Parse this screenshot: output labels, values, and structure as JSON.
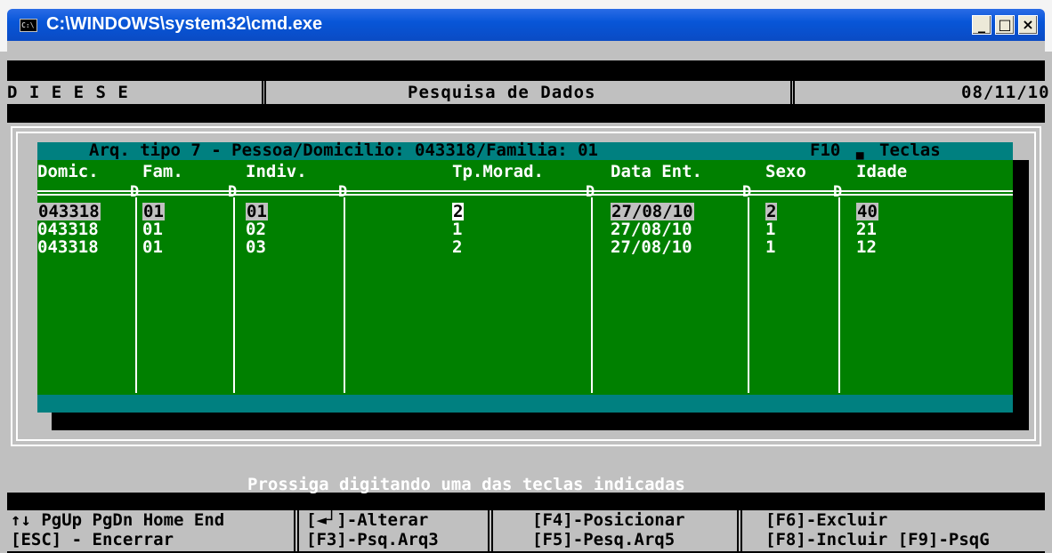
{
  "window": {
    "title": "C:\\WINDOWS\\system32\\cmd.exe",
    "icon_text": "C:\\",
    "minimize": "_",
    "maximize": "□",
    "close": "×"
  },
  "header": {
    "left": "D I E E S E",
    "center": "Pesquisa de Dados",
    "date": "08/11/10"
  },
  "panel": {
    "title": "Arq. tipo 7 - Pessoa/Domicilio: 043318/Familia: 01",
    "help_key": "F10",
    "help_label": "Teclas",
    "columns": [
      "Domic.",
      "Fam.",
      "Indiv.",
      "Tp.Morad.",
      "Data Ent.",
      "Sexo",
      "Idade"
    ],
    "rows": [
      [
        "043318",
        "01",
        "01",
        "2",
        "27/08/10",
        "2",
        "40"
      ],
      [
        "043318",
        "01",
        "02",
        "1",
        "27/08/10",
        "1",
        "21"
      ],
      [
        "043318",
        "01",
        "03",
        "2",
        "27/08/10",
        "1",
        "12"
      ]
    ]
  },
  "status": {
    "prompt": "Prossiga digitando uma das teclas indicadas",
    "keys_line1": [
      "↑↓ PgUp PgDn Home End",
      "[◄┘]-Alterar",
      "[F4]-Posicionar",
      "[F6]-Excluir"
    ],
    "keys_line2": [
      "[ESC] - Encerrar",
      "[F3]-Psq.Arq3",
      "[F5]-Pesq.Arq5",
      "[F8]-Incluir [F9]-PsqG"
    ]
  },
  "colors": {
    "title_bar": "#0a4bc4",
    "panel_green": "#008000",
    "panel_teal": "#008080",
    "console_gray": "#c0c0c0"
  }
}
